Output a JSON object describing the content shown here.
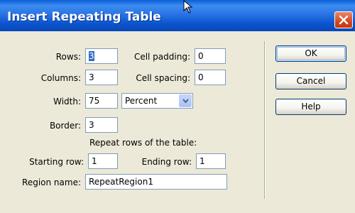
{
  "dialog": {
    "title": "Insert Repeating Table"
  },
  "fields": {
    "rows": {
      "label": "Rows:",
      "value": "3"
    },
    "cell_padding": {
      "label": "Cell padding:",
      "value": "0"
    },
    "columns": {
      "label": "Columns:",
      "value": "3"
    },
    "cell_spacing": {
      "label": "Cell spacing:",
      "value": "0"
    },
    "width": {
      "label": "Width:",
      "value": "75"
    },
    "width_unit": {
      "value": "Percent"
    },
    "border": {
      "label": "Border:",
      "value": "3"
    },
    "repeat_rows_heading": "Repeat rows of the table:",
    "starting_row": {
      "label": "Starting row:",
      "value": "1"
    },
    "ending_row": {
      "label": "Ending row:",
      "value": "1"
    },
    "region_name": {
      "label": "Region name:",
      "value": "RepeatRegion1"
    }
  },
  "buttons": {
    "ok": "OK",
    "cancel": "Cancel",
    "help": "Help"
  }
}
